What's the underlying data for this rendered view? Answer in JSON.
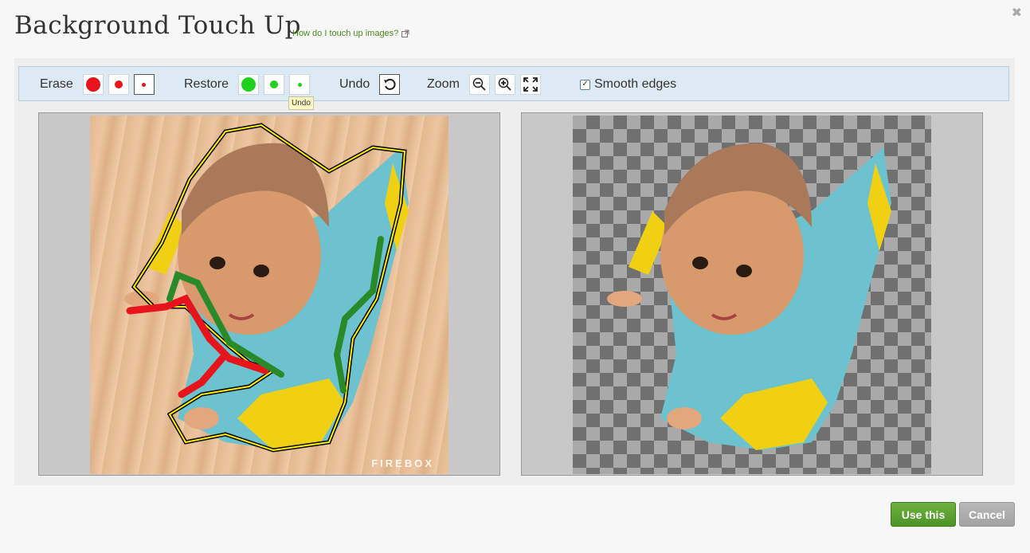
{
  "dialog": {
    "title": "Background Touch Up",
    "help_link": "How do I touch up images?",
    "close_icon": "close-icon"
  },
  "toolbar": {
    "erase_label": "Erase",
    "restore_label": "Restore",
    "undo_label": "Undo",
    "zoom_label": "Zoom",
    "smooth_label": "Smooth edges",
    "smooth_checked": true,
    "erase_color": "#e8141b",
    "restore_color": "#1fd11f",
    "tooltip": "Undo"
  },
  "preview": {
    "watermark": "FIREBOX"
  },
  "footer": {
    "use_label": "Use this",
    "cancel_label": "Cancel"
  }
}
